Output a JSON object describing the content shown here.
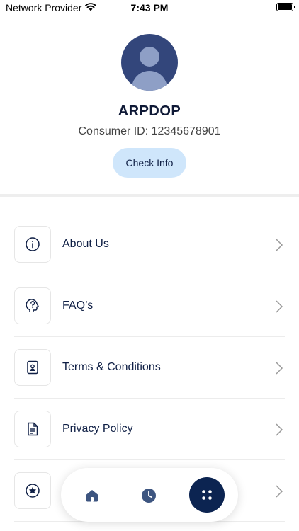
{
  "status_bar": {
    "carrier": "Network Provider",
    "time": "7:43 PM"
  },
  "profile": {
    "name": "ARPDOP",
    "consumer_id": "Consumer ID: 12345678901",
    "check_info_label": "Check Info"
  },
  "menu": {
    "items": [
      {
        "label": "About Us",
        "icon": "info-icon"
      },
      {
        "label": "FAQ’s",
        "icon": "question-head-icon"
      },
      {
        "label": "Terms & Conditions",
        "icon": "document-user-icon"
      },
      {
        "label": "Privacy Policy",
        "icon": "document-text-icon"
      },
      {
        "label": "",
        "icon": "star-circle-icon"
      }
    ]
  },
  "bottom_nav": {
    "items": [
      {
        "name": "home",
        "icon": "home-icon"
      },
      {
        "name": "history",
        "icon": "clock-icon"
      },
      {
        "name": "menu",
        "icon": "grid-dots-icon",
        "active": true
      }
    ]
  },
  "colors": {
    "primary": "#0c2451",
    "avatar_bg": "#33467b",
    "check_info_bg": "#cfe6fb",
    "text": "#0f1f45"
  }
}
